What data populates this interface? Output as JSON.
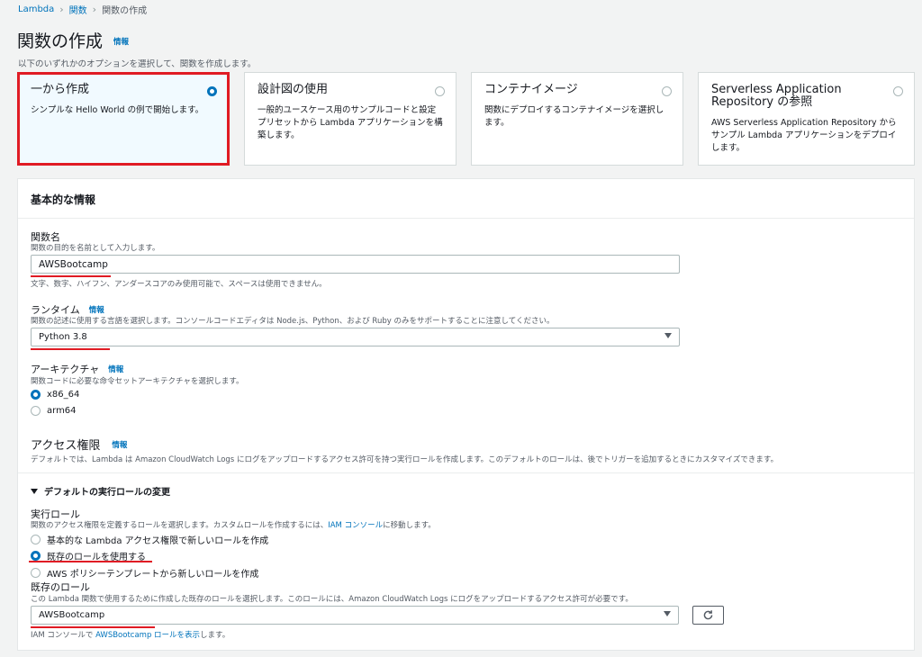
{
  "breadcrumb": {
    "home": "Lambda",
    "parent": "関数",
    "current": "関数の作成"
  },
  "page": {
    "title": "関数の作成",
    "info": "情報",
    "subtitle": "以下のいずれかのオプションを選択して、関数を作成します。"
  },
  "options": [
    {
      "title": "一から作成",
      "desc": "シンプルな Hello World の例で開始します。",
      "selected": true
    },
    {
      "title": "設計図の使用",
      "desc": "一般的ユースケース用のサンプルコードと設定プリセットから Lambda アプリケーションを構築します。",
      "selected": false
    },
    {
      "title": "コンテナイメージ",
      "desc": "関数にデプロイするコンテナイメージを選択します。",
      "selected": false
    },
    {
      "title": "Serverless Application Repository の参照",
      "desc": "AWS Serverless Application Repository からサンプル Lambda アプリケーションをデプロイします。",
      "selected": false
    }
  ],
  "basic": {
    "header": "基本的な情報",
    "function_name": {
      "label": "関数名",
      "hint": "関数の目的を名前として入力します。",
      "value": "AWSBootcamp",
      "constraint": "文字、数字、ハイフン、アンダースコアのみ使用可能で、スペースは使用できません。"
    },
    "runtime": {
      "label": "ランタイム",
      "info": "情報",
      "hint": "関数の記述に使用する言語を選択します。コンソールコードエディタは Node.js、Python、および Ruby のみをサポートすることに注意してください。",
      "value": "Python 3.8"
    },
    "arch": {
      "label": "アーキテクチャ",
      "info": "情報",
      "hint": "関数コードに必要な命令セットアーキテクチャを選択します。",
      "options": [
        "x86_64",
        "arm64"
      ],
      "selected": "x86_64"
    },
    "access": {
      "label": "アクセス権限",
      "info": "情報",
      "hint": "デフォルトでは、Lambda は Amazon CloudWatch Logs にログをアップロードするアクセス許可を持つ実行ロールを作成します。このデフォルトのロールは、後でトリガーを追加するときにカスタマイズできます。"
    },
    "expander": "デフォルトの実行ロールの変更",
    "exec_role": {
      "label": "実行ロール",
      "hint_before": "関数のアクセス権限を定義するロールを選択します。カスタムロールを作成するには、",
      "hint_link": "IAM コンソール",
      "hint_after": "に移動します。",
      "options": [
        "基本的な Lambda アクセス権限で新しいロールを作成",
        "既存のロールを使用する",
        "AWS ポリシーテンプレートから新しいロールを作成"
      ],
      "selected": "既存のロールを使用する"
    },
    "existing_role": {
      "label": "既存のロール",
      "hint": "この Lambda 関数で使用するために作成した既存のロールを選択します。このロールには、Amazon CloudWatch Logs にログをアップロードするアクセス許可が必要です。",
      "value": "AWSBootcamp",
      "footer_before": "IAM コンソールで ",
      "footer_link": "AWSBootcamp ロールを表示",
      "footer_after": "します。"
    }
  },
  "colors": {
    "accent": "#0073bb",
    "highlight": "#e01b24",
    "selected_card_bg": "#f1faff"
  }
}
